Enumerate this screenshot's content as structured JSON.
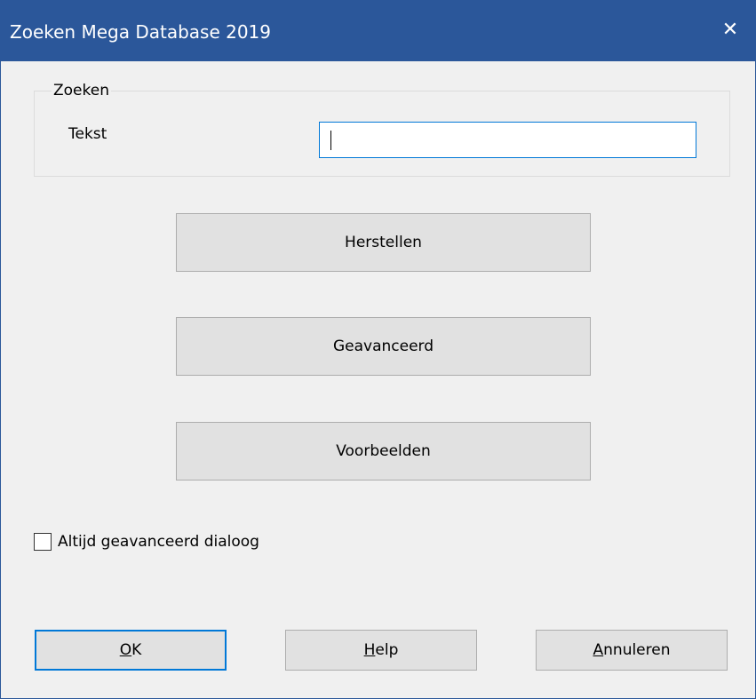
{
  "window": {
    "title": "Zoeken Mega Database 2019",
    "close_glyph": "✕"
  },
  "search_group": {
    "legend": "Zoeken",
    "text_label": "Tekst",
    "text_value": ""
  },
  "buttons": {
    "reset": "Herstellen",
    "advanced": "Geavanceerd",
    "examples": "Voorbeelden"
  },
  "checkbox": {
    "label": "Altijd geavanceerd dialoog",
    "checked": false
  },
  "footer": {
    "ok_mnemonic": "O",
    "ok_rest": "K",
    "help_mnemonic": "H",
    "help_rest": "elp",
    "cancel_mnemonic": "A",
    "cancel_rest": "nnuleren"
  },
  "colors": {
    "titlebar": "#2b579a",
    "focus_accent": "#0078d7",
    "dialog_bg": "#f0f0f0",
    "button_bg": "#e1e1e1"
  }
}
